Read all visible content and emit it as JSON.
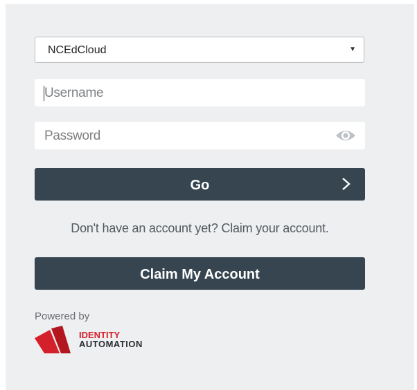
{
  "login": {
    "org_select": {
      "selected": "NCEdCloud",
      "caret": "▼"
    },
    "username": {
      "placeholder": "Username"
    },
    "password": {
      "placeholder": "Password"
    },
    "go_button": {
      "label": "Go"
    },
    "claim_prompt": "Don't have an account yet? Claim your account.",
    "claim_button": {
      "label": "Claim My Account"
    }
  },
  "footer": {
    "powered_by": "Powered by",
    "brand_line1": "IDENTITY",
    "brand_line2": "AUTOMATION"
  },
  "colors": {
    "panel_bg": "#edeff1",
    "button_bg": "#36454f",
    "brand_red": "#d4202a"
  },
  "icons": {
    "password_toggle": "eye-icon",
    "go_arrow": "chevron-right-icon",
    "select_caret": "caret-down-icon"
  }
}
